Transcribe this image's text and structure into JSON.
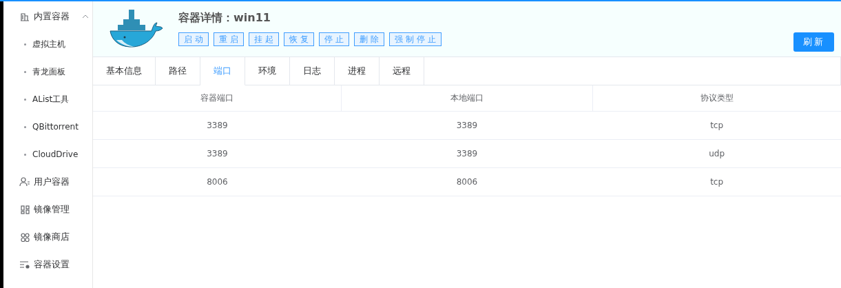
{
  "sidebar": {
    "items": [
      {
        "label": "内置容器",
        "expanded": true,
        "children": [
          {
            "label": "虚拟主机"
          },
          {
            "label": "青龙面板"
          },
          {
            "label": "AList工具"
          },
          {
            "label": "QBittorrent"
          },
          {
            "label": "CloudDrive"
          }
        ]
      },
      {
        "label": "用户容器"
      },
      {
        "label": "镜像管理"
      },
      {
        "label": "镜像商店"
      },
      {
        "label": "容器设置"
      }
    ]
  },
  "header": {
    "title": "容器详情：win11",
    "actions": [
      "启动",
      "重启",
      "挂起",
      "恢复",
      "停止",
      "删除",
      "强制停止"
    ],
    "refresh": "刷新"
  },
  "tabs": [
    {
      "label": "基本信息",
      "selected": false
    },
    {
      "label": "路径",
      "selected": false
    },
    {
      "label": "端口",
      "selected": true
    },
    {
      "label": "环境",
      "selected": false
    },
    {
      "label": "日志",
      "selected": false
    },
    {
      "label": "进程",
      "selected": false
    },
    {
      "label": "远程",
      "selected": false
    }
  ],
  "table": {
    "columns": [
      "容器端口",
      "本地端口",
      "协议类型"
    ],
    "rows": [
      [
        "3389",
        "3389",
        "tcp"
      ],
      [
        "3389",
        "3389",
        "udp"
      ],
      [
        "8006",
        "8006",
        "tcp"
      ]
    ]
  }
}
